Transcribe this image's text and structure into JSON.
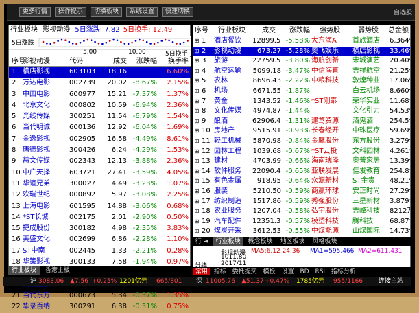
{
  "toolbar": {
    "buttons": [
      "更多行情",
      "操作提示",
      "切换板块",
      "系统设置",
      "快速切换"
    ],
    "right_text": "自选股"
  },
  "left_panel": {
    "header": {
      "prefix": "行业板块",
      "name": "影视动漫",
      "chg": "5日涨跌: 7.82",
      "turn": "5日换手: 12.49"
    },
    "sparkline": {
      "label_left": "5日涨跌",
      "ticks": [
        "5.00",
        "10.00"
      ],
      "label_right": "5日换手"
    },
    "columns": [
      "序号",
      "影视动漫",
      "代码",
      "成交",
      "涨跌幅",
      "换手率"
    ],
    "rows": [
      {
        "n": "1",
        "name": "横店影视",
        "code": "603103",
        "price": "18.16",
        "chg": "",
        "turn": "6.60%"
      },
      {
        "n": "2",
        "name": "万达电影",
        "code": "002739",
        "price": "20.02",
        "chg": "-8.67%",
        "turn": "2.15%"
      },
      {
        "n": "3",
        "name": "中国电影",
        "code": "600977",
        "price": "15.21",
        "chg": "-7.37%",
        "turn": "1.37%"
      },
      {
        "n": "4",
        "name": "北京文化",
        "code": "000802",
        "price": "10.59",
        "chg": "-6.94%",
        "turn": "2.36%"
      },
      {
        "n": "5",
        "name": "光线传媒",
        "code": "300251",
        "price": "11.54",
        "chg": "-6.79%",
        "turn": "1.54%"
      },
      {
        "n": "6",
        "name": "当代明诚",
        "code": "600136",
        "price": "12.92",
        "chg": "-6.04%",
        "turn": "1.69%"
      },
      {
        "n": "7",
        "name": "金逸影视",
        "code": "002905",
        "price": "16.58",
        "chg": "-4.49%",
        "turn": "8.61%"
      },
      {
        "n": "8",
        "name": "唐德影视",
        "code": "300426",
        "price": "6.24",
        "chg": "-4.29%",
        "turn": "1.53%"
      },
      {
        "n": "9",
        "name": "慈文传媒",
        "code": "002343",
        "price": "12.13",
        "chg": "-3.88%",
        "turn": "2.36%"
      },
      {
        "n": "10",
        "name": "中广天择",
        "code": "603721",
        "price": "27.41",
        "chg": "-3.59%",
        "turn": "4.05%"
      },
      {
        "n": "11",
        "name": "华谊兄弟",
        "code": "300027",
        "price": "4.49",
        "chg": "-3.23%",
        "turn": "1.07%"
      },
      {
        "n": "12",
        "name": "欢瑞世纪",
        "code": "000892",
        "price": "5.97",
        "chg": "-3.08%",
        "turn": "2.25%"
      },
      {
        "n": "13",
        "name": "上海电影",
        "code": "601595",
        "price": "14.88",
        "chg": "-3.06%",
        "turn": "0.68%"
      },
      {
        "n": "14",
        "name": "*ST长城",
        "code": "002175",
        "price": "2.01",
        "chg": "-2.90%",
        "turn": "0.50%"
      },
      {
        "n": "15",
        "name": "捷成股份",
        "code": "300182",
        "price": "4.98",
        "chg": "-2.35%",
        "turn": "3.83%"
      },
      {
        "n": "16",
        "name": "美盛文化",
        "code": "002699",
        "price": "6.86",
        "chg": "-2.28%",
        "turn": "1.10%"
      },
      {
        "n": "17",
        "name": "ST中南",
        "code": "002445",
        "price": "1.33",
        "chg": "-2.21%",
        "turn": "0.28%"
      },
      {
        "n": "18",
        "name": "华策影视",
        "code": "300133",
        "price": "7.58",
        "chg": "-1.94%",
        "turn": "0.97%"
      },
      {
        "n": "19",
        "name": "长城影视",
        "code": "002071",
        "price": "3.19",
        "chg": "-1.85%",
        "turn": "0.72%"
      },
      {
        "n": "20",
        "name": "文投控股",
        "code": "600715",
        "price": "3.46",
        "chg": "-1.42%",
        "turn": "0.25%"
      },
      {
        "n": "21",
        "name": "当代东方",
        "code": "000673",
        "price": "5.34",
        "chg": "-0.37%",
        "turn": "1.35%"
      },
      {
        "n": "22",
        "name": "华录百纳",
        "code": "300291",
        "price": "6.38",
        "chg": "-0.31%",
        "turn": "0.75%"
      }
    ],
    "tabs": [
      "行业板块",
      "香港主板"
    ]
  },
  "right_panel": {
    "columns": [
      "序号",
      "行业板块",
      "成交",
      "涨跌幅",
      "强势股",
      "弱势股",
      "总金额"
    ],
    "rows": [
      {
        "n": "1",
        "name": "酒店餐饮",
        "vol": "12899.56",
        "chg": "-5.58%",
        "strong": "大东海A",
        "weak": "首旅酒店",
        "tot": "6.364亿"
      },
      {
        "n": "2",
        "name": "影视动漫",
        "vol": "673.27",
        "chg": "-5.28%",
        "strong": "奥飞娱乐",
        "weak": "横店影视",
        "tot": "33.46亿"
      },
      {
        "n": "3",
        "name": "旅游",
        "vol": "22759.59",
        "chg": "-3.80%",
        "strong": "海航创新",
        "weak": "宋城演艺",
        "tot": "20.40亿"
      },
      {
        "n": "4",
        "name": "航空运输",
        "vol": "5099.18",
        "chg": "-3.47%",
        "strong": "中信海直",
        "weak": "吉祥航空",
        "tot": "21.25亿"
      },
      {
        "n": "5",
        "name": "农林",
        "vol": "8696.43",
        "chg": "-2.22%",
        "strong": "中粮科技",
        "weak": "敦煌种业",
        "tot": "17.06亿"
      },
      {
        "n": "6",
        "name": "机场",
        "vol": "6671.55",
        "chg": "-1.87%",
        "strong": "",
        "weak": "白云机场",
        "tot": "8.660亿"
      },
      {
        "n": "7",
        "name": "黄金",
        "vol": "1343.52",
        "chg": "-1.46%",
        "strong": "*ST刚泰",
        "weak": "荣华实业",
        "tot": "11.68亿"
      },
      {
        "n": "8",
        "name": "文化传媒",
        "vol": "4974.87",
        "chg": "-1.44%",
        "strong": "",
        "weak": "文化引力",
        "tot": "54.53亿"
      },
      {
        "n": "9",
        "name": "酿酒",
        "vol": "62906.40",
        "chg": "-1.31%",
        "strong": "建骛资源",
        "weak": "酒鬼酒",
        "tot": "254.5亿"
      },
      {
        "n": "10",
        "name": "房地产",
        "vol": "9515.91",
        "chg": "-0.93%",
        "strong": "长春经开",
        "weak": "中珠医疗",
        "tot": "59.69亿"
      },
      {
        "n": "11",
        "name": "轻工机械",
        "vol": "5870.98",
        "chg": "-0.84%",
        "strong": "金鹰股份",
        "weak": "东方股份",
        "tot": "3.279亿"
      },
      {
        "n": "12",
        "name": "园林工程",
        "vol": "1039.68",
        "chg": "-0.67%",
        "strong": "*ST云投",
        "weak": "文科园林",
        "tot": "4.261亿"
      },
      {
        "n": "13",
        "name": "建材",
        "vol": "4703.99",
        "chg": "-0.66%",
        "strong": "海南瑞泽",
        "weak": "奥普家居",
        "tot": "13.39亿"
      },
      {
        "n": "14",
        "name": "软件服务",
        "vol": "22090.44",
        "chg": "-0.65%",
        "strong": "亚联发展",
        "weak": "佳发教育",
        "tot": "254.8亿"
      },
      {
        "n": "15",
        "name": "有色金属",
        "vol": "918.95",
        "chg": "-0.64%",
        "strong": "众源新材",
        "weak": "ST金贵",
        "tot": "48.21亿"
      },
      {
        "n": "16",
        "name": "服装",
        "vol": "5210.50",
        "chg": "-0.59%",
        "strong": "商赢环球",
        "weak": "安正时尚",
        "tot": "27.29亿"
      },
      {
        "n": "17",
        "name": "纺织制造",
        "vol": "1517.86",
        "chg": "-0.59%",
        "strong": "秀强股份",
        "weak": "三星新材",
        "tot": "3.879亿"
      },
      {
        "n": "18",
        "name": "农业服务",
        "vol": "1207.04",
        "chg": "-0.58%",
        "strong": "弘宇股份",
        "weak": "吉峰科技",
        "tot": "8212万"
      },
      {
        "n": "19",
        "name": "汽车配件",
        "vol": "12351.37",
        "chg": "-0.57%",
        "strong": "模塑科技",
        "weak": "腾科技",
        "tot": "68.87亿"
      },
      {
        "n": "20",
        "name": "煤炭开采",
        "vol": "3612.53",
        "chg": "-0.55%",
        "strong": "中煤能源",
        "weak": "山煤国际",
        "tot": "14.73亿"
      },
      {
        "n": "21",
        "name": "化肥",
        "vol": "3150.70",
        "chg": "-0.51%",
        "strong": "*ST河化",
        "weak": "ST柳化",
        "tot": "8.123亿"
      },
      {
        "n": "22",
        "name": "汽车制造",
        "vol": "12590.07",
        "chg": "-0.49%",
        "strong": "中通客车",
        "weak": "东方精工",
        "tot": "26.96亿"
      }
    ],
    "tabs": [
      "行业板块",
      "概念板块",
      "地区板块",
      "风格板块"
    ]
  },
  "mini_chart": {
    "title": "影视动漫",
    "ma": "MA5:6.12 24.36",
    "ma1": "MA1=595.466",
    "ma2": "MA2=611.431",
    "value": "1011.80",
    "date": "2017/11",
    "label": "分线"
  },
  "status_bar": {
    "sh": "沪",
    "sh_val": "3083.06",
    "sh_chg": "▲7.56",
    "sh_pct": "+0.25%",
    "sh_amt": "1201亿元",
    "sh_cnt": "665/801",
    "sz": "深",
    "sz_val": "11005.76",
    "sz_chg": "▲51.37",
    "sz_pct": "+0.47%",
    "sz_amt": "1785亿元",
    "sz_cnt": "955/1166",
    "right": "连接主站"
  },
  "bottom_menu": [
    "常用",
    "指标",
    "委托提交",
    "模板",
    "设置",
    "BD",
    "RSI",
    "指标分析"
  ]
}
